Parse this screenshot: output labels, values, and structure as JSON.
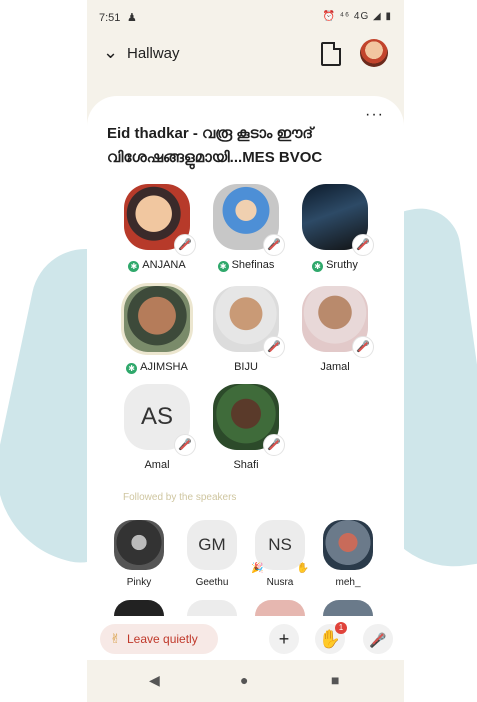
{
  "status": {
    "time": "7:51",
    "bell": "♟",
    "right": "⏰ ⁴⁶ 4G ◢ ▮"
  },
  "topbar": {
    "room_name": "Hallway",
    "back_icon": "chevron-down-icon",
    "doc_icon": "document-icon"
  },
  "room": {
    "title": "Eid thadkar - വരൂ കൂടാം ഈദ് വിശേഷങ്ങളുമായി...MES BVOC",
    "more": "···"
  },
  "speakers": [
    {
      "name": "ANJANA",
      "badge": true
    },
    {
      "name": "Shefinas",
      "badge": true
    },
    {
      "name": "Sruthy",
      "badge": true
    },
    {
      "name": "AJIMSHA",
      "badge": true
    },
    {
      "name": "BIJU",
      "badge": false
    },
    {
      "name": "Jamal",
      "badge": false
    },
    {
      "name": "Amal",
      "initials": "AS",
      "badge": false
    },
    {
      "name": "Shafi",
      "badge": false
    }
  ],
  "followed_label": "Followed by the speakers",
  "listeners": [
    {
      "name": "Pinky"
    },
    {
      "name": "Geethu",
      "initials": "GM"
    },
    {
      "name": "Nusra",
      "initials": "NS"
    },
    {
      "name": "meh_"
    }
  ],
  "bottom": {
    "leave_label": "Leave quietly",
    "hand_badge": "1"
  },
  "navbar": {
    "back": "◀",
    "home": "●",
    "recents": "■"
  }
}
